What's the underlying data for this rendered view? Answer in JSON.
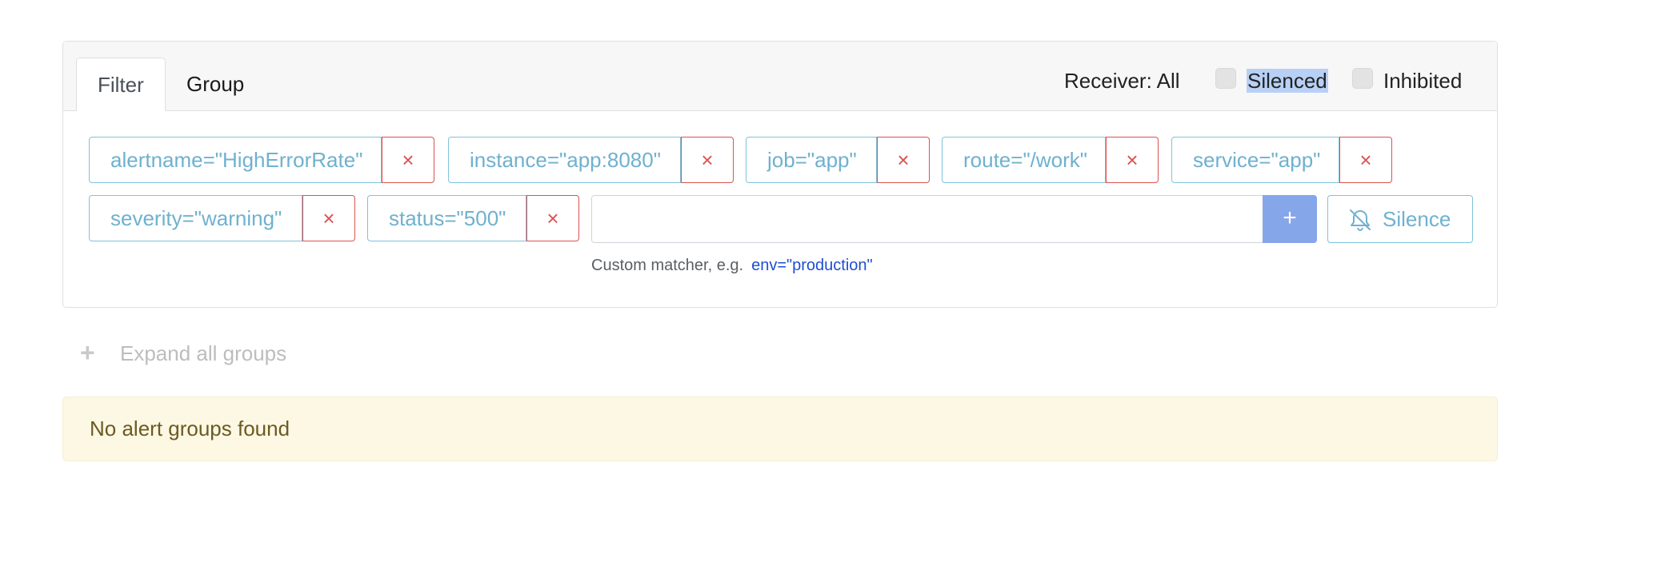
{
  "tabs": [
    {
      "label": "Filter",
      "active": true
    },
    {
      "label": "Group",
      "active": false
    }
  ],
  "receiver": {
    "label": "Receiver: All"
  },
  "toggles": {
    "silenced": {
      "label": "Silenced",
      "checked": false
    },
    "inhibited": {
      "label": "Inhibited",
      "checked": false
    }
  },
  "matchers": [
    {
      "label": "alertname=\"HighErrorRate\"",
      "remove": "×"
    },
    {
      "label": "instance=\"app:8080\"",
      "remove": "×"
    },
    {
      "label": "job=\"app\"",
      "remove": "×"
    },
    {
      "label": "route=\"/work\"",
      "remove": "×"
    },
    {
      "label": "service=\"app\"",
      "remove": "×"
    },
    {
      "label": "severity=\"warning\"",
      "remove": "×"
    },
    {
      "label": "status=\"500\"",
      "remove": "×"
    }
  ],
  "custom_matcher": {
    "value": "",
    "add_label": "+",
    "hint": "Custom matcher, e.g.",
    "hint_example": "env=\"production\""
  },
  "silence_button": {
    "label": "Silence",
    "icon": "bell-slash-icon"
  },
  "expand": {
    "label": "Expand all groups",
    "icon": "plus-icon"
  },
  "alert": {
    "message": "No alert groups found"
  },
  "colors": {
    "matcher_border": "#7ec3dc",
    "matcher_text": "#6fb1cf",
    "remove_red": "#d9534f",
    "add_button": "#86a6ea",
    "alert_bg": "#fcf8e3",
    "alert_text": "#6c5a23",
    "hint_link": "#1d4fd1"
  }
}
